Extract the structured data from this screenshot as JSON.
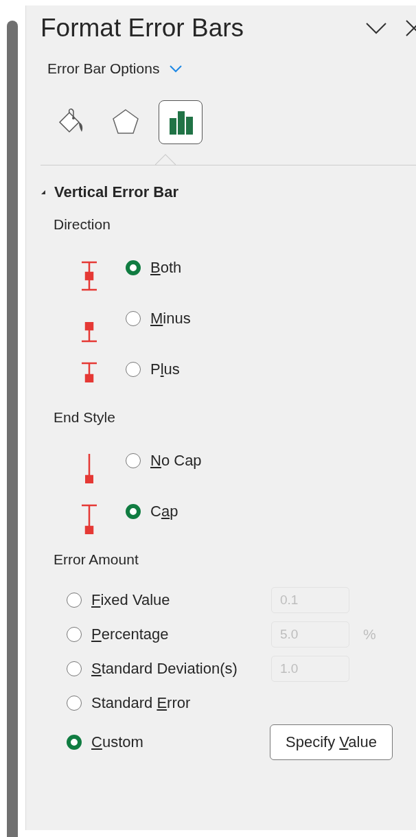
{
  "pane": {
    "title": "Format Error Bars",
    "options_menu": "Error Bar Options"
  },
  "tabs": [
    {
      "kind": "fill",
      "selected": false
    },
    {
      "kind": "effects",
      "selected": false
    },
    {
      "kind": "options",
      "selected": true
    }
  ],
  "section": {
    "title": "Vertical Error Bar",
    "expanded": true
  },
  "direction": {
    "label": "Direction",
    "options": [
      {
        "kind": "both",
        "key": "B",
        "post": "oth",
        "selected": true
      },
      {
        "kind": "minus",
        "key": "M",
        "post": "inus",
        "selected": false
      },
      {
        "kind": "plus",
        "pre": "P",
        "key": "l",
        "post": "us",
        "selected": false
      }
    ]
  },
  "end_style": {
    "label": "End Style",
    "options": [
      {
        "kind": "nocap",
        "key": "N",
        "post": "o Cap",
        "selected": false
      },
      {
        "kind": "cap",
        "pre": "C",
        "key": "a",
        "post": "p",
        "selected": true
      }
    ]
  },
  "error_amount": {
    "label": "Error Amount",
    "options": [
      {
        "key": "F",
        "post": "ixed Value",
        "selected": false,
        "input": {
          "value": "0.1",
          "disabled": true
        }
      },
      {
        "key": "P",
        "post": "ercentage",
        "selected": false,
        "input": {
          "value": "5.0",
          "disabled": true,
          "unit": "%"
        }
      },
      {
        "key": "S",
        "post": "tandard Deviation(s)",
        "selected": false,
        "input": {
          "value": "1.0",
          "disabled": true
        }
      },
      {
        "pre": "Standard ",
        "key": "E",
        "post": "rror",
        "selected": false
      },
      {
        "key": "C",
        "post": "ustom",
        "selected": true,
        "button": {
          "pre": "Specify ",
          "key": "V",
          "post": "alue"
        }
      }
    ]
  }
}
